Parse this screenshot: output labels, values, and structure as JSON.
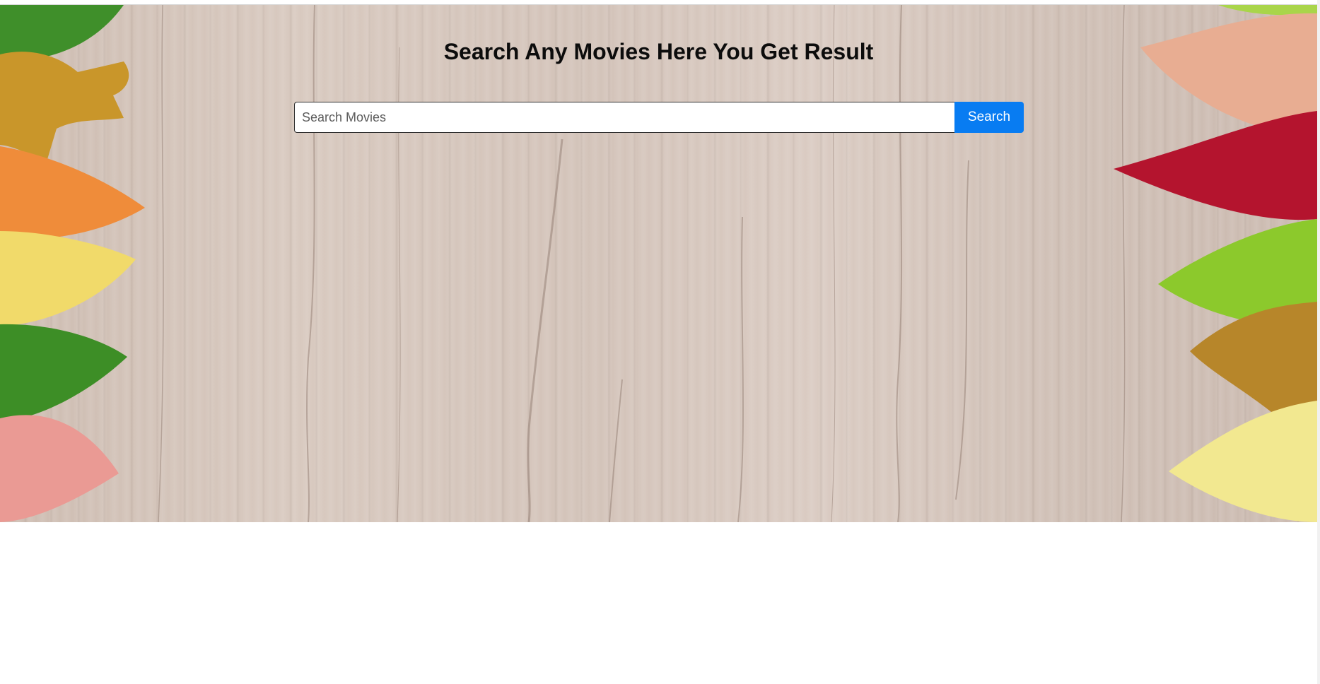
{
  "page": {
    "title": "Search Any Movies Here You Get Result"
  },
  "search": {
    "placeholder": "Search Movies",
    "value": "",
    "button_label": "Search"
  },
  "colors": {
    "button": "#087cf2",
    "button_text": "#ffffff",
    "title": "#0c0c0c",
    "page_background": "#ffffff"
  },
  "background": {
    "image": "wood-planks-with-autumn-leaves"
  }
}
